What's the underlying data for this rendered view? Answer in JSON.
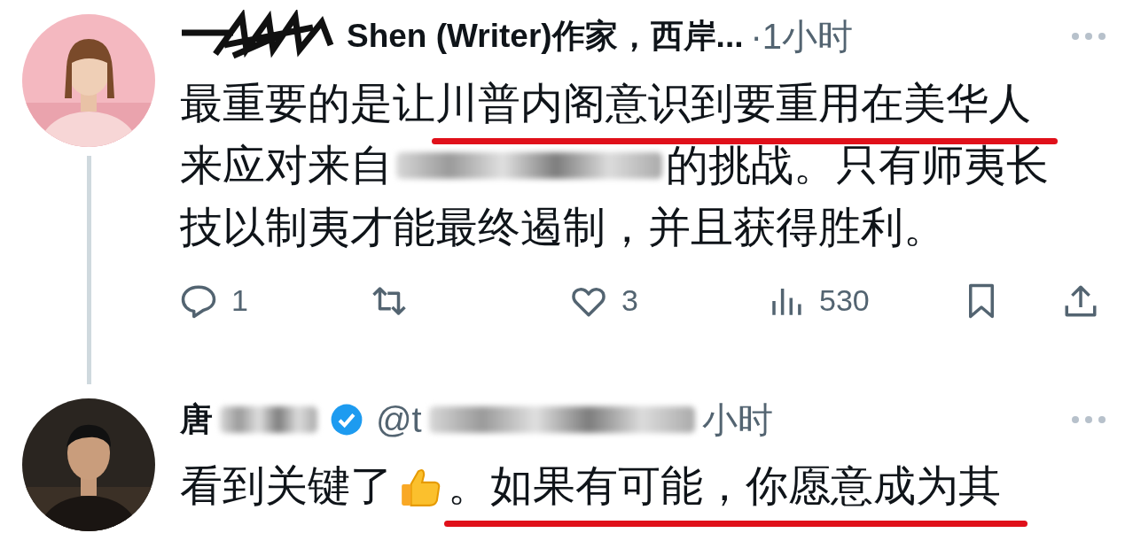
{
  "tweets": [
    {
      "avatar": {
        "kind": "picture"
      },
      "name": "Shen (Writer)作家，西岸...",
      "name_mask": {
        "kind": "scribble"
      },
      "verified": false,
      "time": "·1小时",
      "time_redacted": false,
      "thread_line": true,
      "lines": [
        {
          "segments": [
            {
              "kind": "text",
              "text": "最重要的是让",
              "underlined": false
            },
            {
              "kind": "text",
              "text": "川普内阁意识到要重用在美华人",
              "underlined": true
            }
          ]
        },
        {
          "segments": [
            {
              "kind": "text",
              "text": "来应对来自",
              "underlined": false
            },
            {
              "kind": "blur"
            },
            {
              "kind": "text",
              "text": "的挑战。只有师夷长",
              "underlined": false
            }
          ]
        },
        {
          "segments": [
            {
              "kind": "text",
              "text": "技以制夷才能最终遏制，并且获得胜利。",
              "underlined": false
            }
          ]
        }
      ],
      "actions": [
        {
          "kind": "reply",
          "count": "1"
        },
        {
          "kind": "retweet"
        },
        {
          "kind": "like",
          "count": "3"
        },
        {
          "kind": "views",
          "count": "530"
        },
        {
          "kind": "bookmark"
        },
        {
          "kind": "share"
        }
      ]
    },
    {
      "avatar": {
        "kind": "picture"
      },
      "name": "唐",
      "name_mask": {
        "kind": "blur"
      },
      "verified": true,
      "handle": "@t",
      "time": "小时",
      "time_redacted": true,
      "thread_line": false,
      "lines": [
        {
          "segments": [
            {
              "kind": "text",
              "text": "看到关键了",
              "underlined": false
            },
            {
              "kind": "thumbs"
            },
            {
              "kind": "text",
              "text": "。如果有可能，你愿意成为其",
              "underlined": true
            }
          ]
        }
      ]
    }
  ]
}
